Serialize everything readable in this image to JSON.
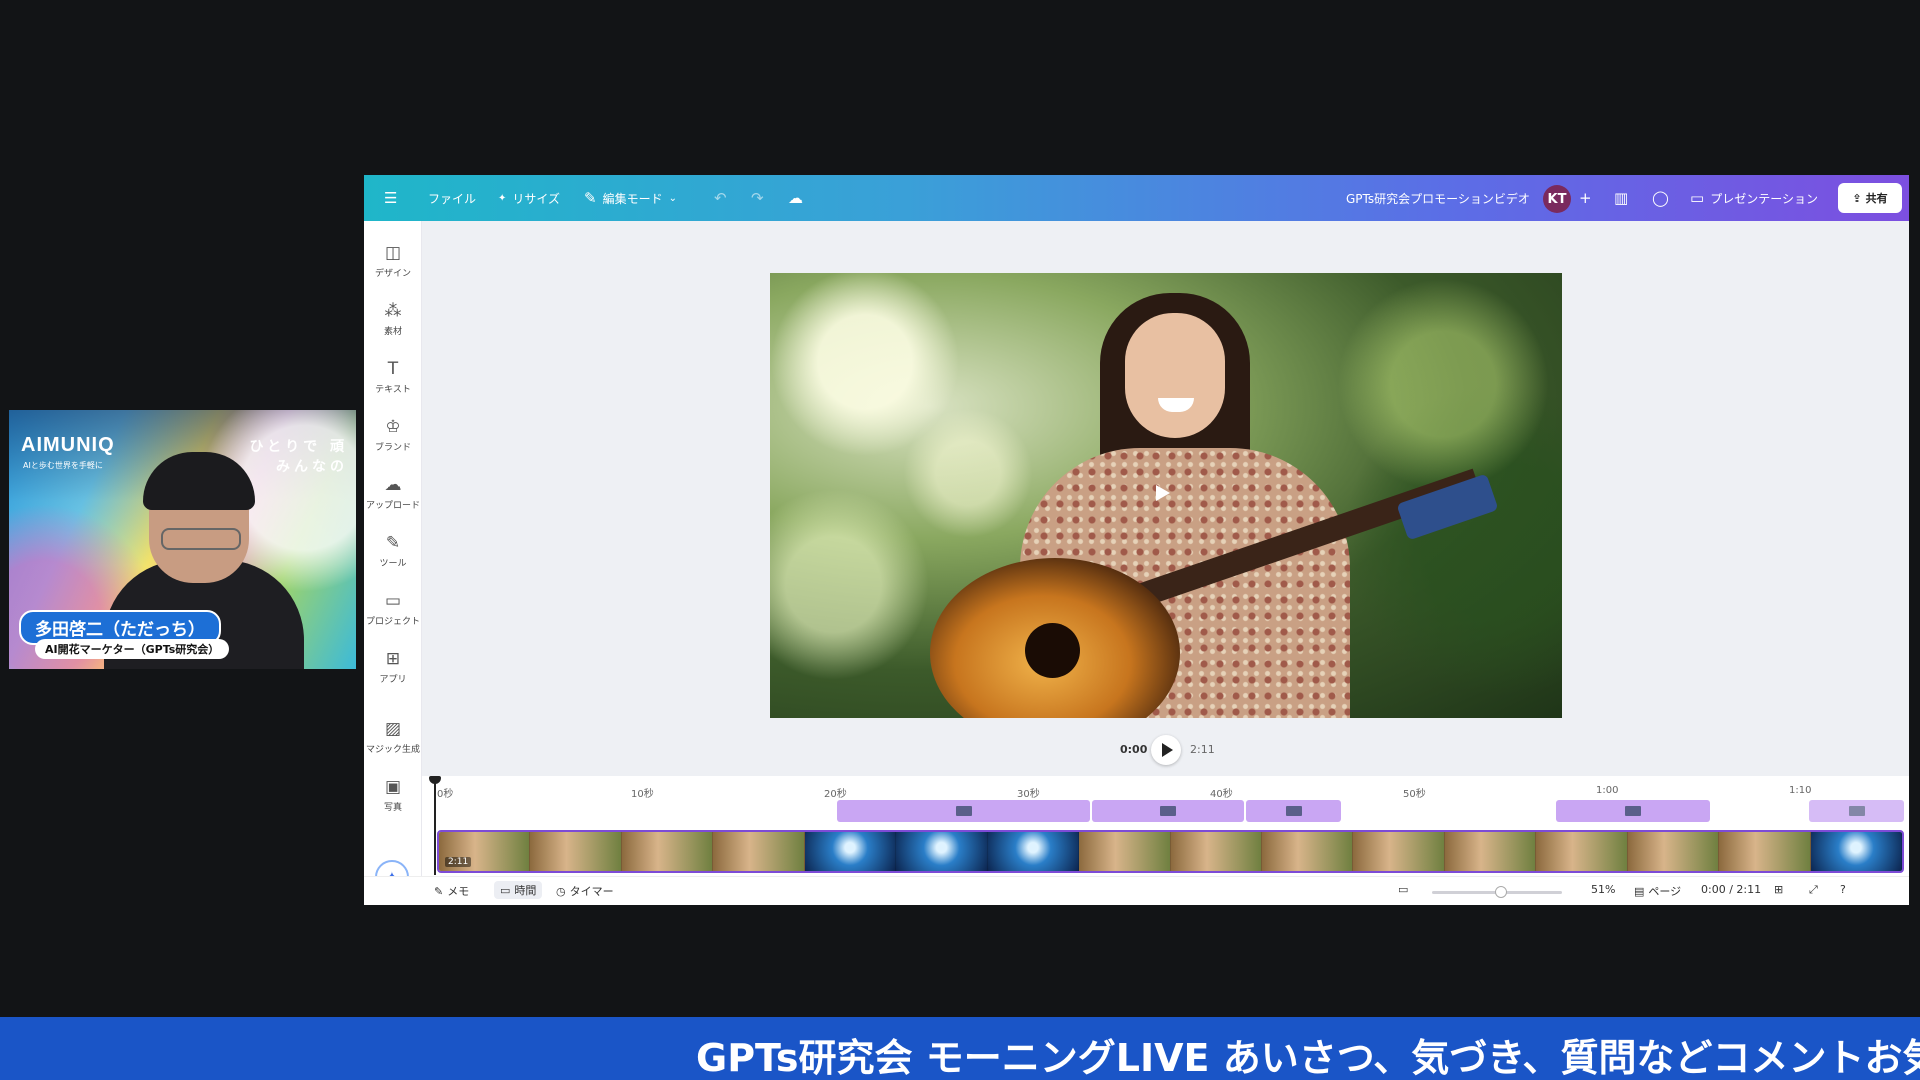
{
  "webcam": {
    "logo": "AIMUNIQ",
    "logo_sub": "AIと歩む世界を手軽に",
    "slogan_line1": "ひとりで 頑",
    "slogan_line2": "みんなの",
    "name": "多田啓二（ただっち）",
    "role": "AI開花マーケター（GPTs研究会）"
  },
  "topbar": {
    "menu_icon": "menu-icon",
    "file": "ファイル",
    "resize": "リサイズ",
    "edit_mode": "編集モード",
    "project_title": "GPTs研究会プロモーションビデオ",
    "avatar_initials": "KT",
    "add": "+",
    "present": "プレゼンテーション",
    "share": "共有"
  },
  "sidebar": {
    "items": [
      {
        "label": "デザイン",
        "icon": "layout-icon",
        "glyph": "◫"
      },
      {
        "label": "素材",
        "icon": "elements-icon",
        "glyph": "⁂"
      },
      {
        "label": "テキスト",
        "icon": "text-icon",
        "glyph": "T"
      },
      {
        "label": "ブランド",
        "icon": "brand-icon",
        "glyph": "♔"
      },
      {
        "label": "アップロード",
        "icon": "upload-icon",
        "glyph": "☁"
      },
      {
        "label": "ツール",
        "icon": "pen-icon",
        "glyph": "✎"
      },
      {
        "label": "プロジェクト",
        "icon": "folder-icon",
        "glyph": "▭"
      },
      {
        "label": "アプリ",
        "icon": "apps-icon",
        "glyph": "⊞"
      },
      {
        "label": "マジック生成",
        "icon": "magic-image-icon",
        "glyph": "▨"
      },
      {
        "label": "写真",
        "icon": "photo-icon",
        "glyph": "▣"
      }
    ]
  },
  "playback": {
    "current": "0:00",
    "total": "2:11"
  },
  "timeline": {
    "ruler": [
      "0秒",
      "10秒",
      "20秒",
      "30秒",
      "40秒",
      "50秒",
      "1:00",
      "1:10"
    ],
    "clip_duration": "2:11"
  },
  "bottombar": {
    "notes": "メモ",
    "duration": "時間",
    "timer": "タイマー",
    "zoom": "51%",
    "pages": "ページ",
    "time": "0:00 / 2:11"
  },
  "ticker": "GPTs研究会 モーニングLIVE あいさつ、気づき、質問などコメントお気",
  "colors": {
    "topbar_start": "#1fb6c9",
    "topbar_end": "#7c4fe0",
    "timeline_clip": "#c9a6f3",
    "ticker_bg": "#1a55c7"
  }
}
